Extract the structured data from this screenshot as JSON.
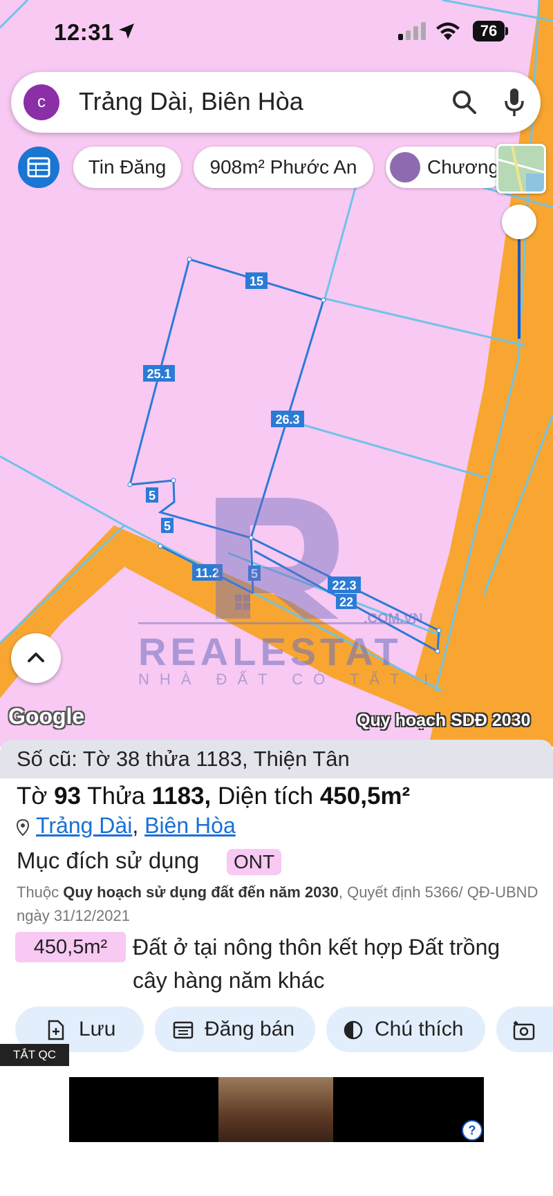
{
  "status_bar": {
    "time": "12:31",
    "battery": "76"
  },
  "search": {
    "avatar_letter": "c",
    "query": "Trảng Dài, Biên Hòa"
  },
  "chips": [
    {
      "label": "Tin Đăng"
    },
    {
      "label": "908m² Phước An"
    },
    {
      "label": "Chương"
    }
  ],
  "map": {
    "google_logo": "Google",
    "layer_label": "Quy hoạch SDĐ 2030",
    "edge_labels": [
      "15",
      "25.1",
      "26.3",
      "5",
      "5",
      "11.2",
      "5",
      "22.3",
      "22"
    ],
    "colors": {
      "residential_pink": "#f7c9f3",
      "road_orange": "#f8a631",
      "parcel_blue": "#2b7bd6"
    },
    "watermark": {
      "brand": "REALESTAT",
      "domain": ".COM.VN",
      "slogan": "NHÀ ĐẤT CÓ TẤT !"
    }
  },
  "parcel": {
    "old_number": "Số cũ: Tờ 38 thửa 1183, Thiện Tân",
    "title": {
      "sheet_label": "Tờ",
      "sheet": "93",
      "lot_label": "Thửa",
      "lot": "1183,",
      "area_label": "Diện tích",
      "area": "450,5m²"
    },
    "ward": "Trảng Dài",
    "city": "Biên Hòa",
    "purpose_label": "Mục đích sử dụng",
    "purpose_code": "ONT",
    "plan_prefix": "Thuộc",
    "plan_name": "Quy hoạch sử dụng đất đến năm 2030",
    "plan_decision": ", Quyết định 5366/ QĐ-UBND ngày 31/12/2021",
    "zone_area": "450,5m²",
    "zone_desc_line1": "Đất ở tại nông thôn kết hợp Đất trồng",
    "zone_desc_line2": "cây hàng năm khác"
  },
  "actions": [
    {
      "label": "Lưu"
    },
    {
      "label": "Đăng bán"
    },
    {
      "label": "Chú thích"
    }
  ],
  "ad": {
    "tag": "TẮT QC",
    "help": "?"
  }
}
